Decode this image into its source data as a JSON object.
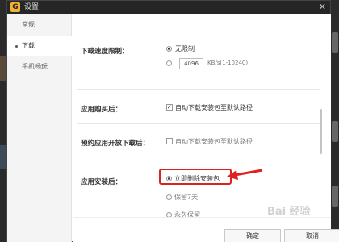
{
  "window": {
    "title": "设置",
    "logo_letter": "G"
  },
  "sidebar": {
    "items": [
      {
        "label": "常规"
      },
      {
        "label": "下载"
      },
      {
        "label": "手机畅玩"
      }
    ]
  },
  "download_speed": {
    "label": "下载速度限制：",
    "option_unlimited": "无限制",
    "limit_value": "4096",
    "limit_unit": "KB/s(1-10240)"
  },
  "after_purchase": {
    "label": "应用购买后：",
    "option": "自动下载安装包至默认路径"
  },
  "reserved_app": {
    "label": "预约应用开放下载后：",
    "option": "自动下载安装包至默认路径"
  },
  "after_install": {
    "label": "应用安装后：",
    "options": [
      "立即删除安装包",
      "保留7天",
      "永久保留"
    ]
  },
  "footer": {
    "ok": "确定",
    "cancel": "取消"
  },
  "watermark": "Bai 经验",
  "colors": {
    "annotation": "#e02020",
    "titlebar": "#262626",
    "logo": "#f2b134"
  }
}
